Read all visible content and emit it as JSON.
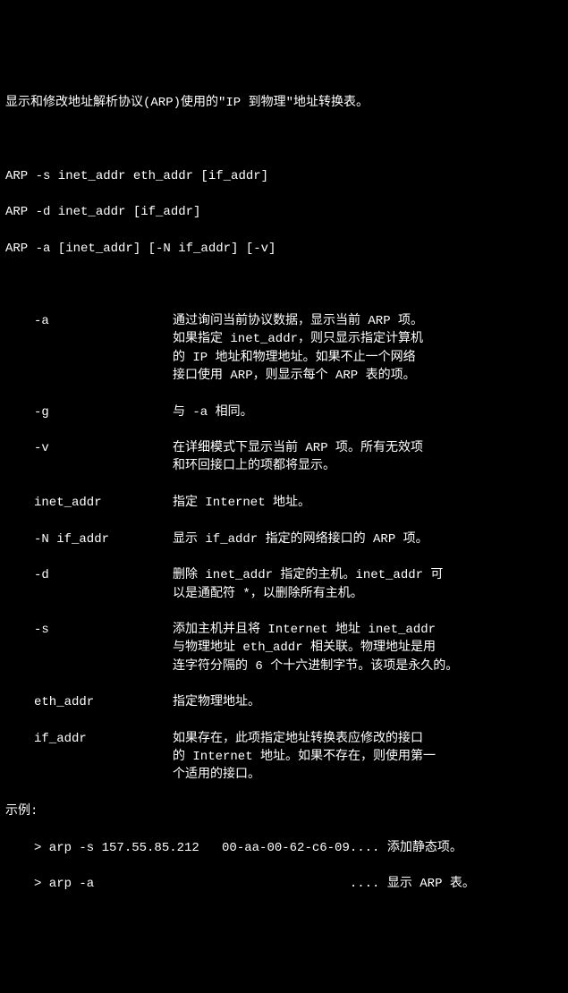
{
  "header": "显示和修改地址解析协议(ARP)使用的\"IP 到物理\"地址转换表。",
  "usage": [
    "ARP -s inet_addr eth_addr [if_addr]",
    "ARP -d inet_addr [if_addr]",
    "ARP -a [inet_addr] [-N if_addr] [-v]"
  ],
  "options": [
    {
      "flag": "-a",
      "desc": [
        "通过询问当前协议数据，显示当前 ARP 项。",
        "如果指定 inet_addr，则只显示指定计算机",
        "的 IP 地址和物理地址。如果不止一个网络",
        "接口使用 ARP，则显示每个 ARP 表的项。"
      ]
    },
    {
      "flag": "-g",
      "desc": [
        "与 -a 相同。"
      ]
    },
    {
      "flag": "-v",
      "desc": [
        "在详细模式下显示当前 ARP 项。所有无效项",
        "和环回接口上的项都将显示。"
      ]
    },
    {
      "flag": "inet_addr",
      "desc": [
        "指定 Internet 地址。"
      ]
    },
    {
      "flag": "-N if_addr",
      "desc": [
        "显示 if_addr 指定的网络接口的 ARP 项。"
      ]
    },
    {
      "flag": "-d",
      "desc": [
        "删除 inet_addr 指定的主机。inet_addr 可",
        "以是通配符 *，以删除所有主机。"
      ]
    },
    {
      "flag": "-s",
      "desc": [
        "添加主机并且将 Internet 地址 inet_addr",
        "与物理地址 eth_addr 相关联。物理地址是用",
        "连字符分隔的 6 个十六进制字节。该项是永久的。"
      ]
    },
    {
      "flag": "eth_addr",
      "desc": [
        "指定物理地址。"
      ]
    },
    {
      "flag": "if_addr",
      "desc": [
        "如果存在，此项指定地址转换表应修改的接口",
        "的 Internet 地址。如果不存在，则使用第一",
        "个适用的接口。"
      ]
    }
  ],
  "examples_label": "示例:",
  "examples": [
    {
      "cmd": "> arp -s 157.55.85.212   00-aa-00-62-c6-09....",
      "note": "添加静态项。"
    },
    {
      "cmd": "> arp -a                                  ....",
      "note": "显示 ARP 表。"
    }
  ]
}
